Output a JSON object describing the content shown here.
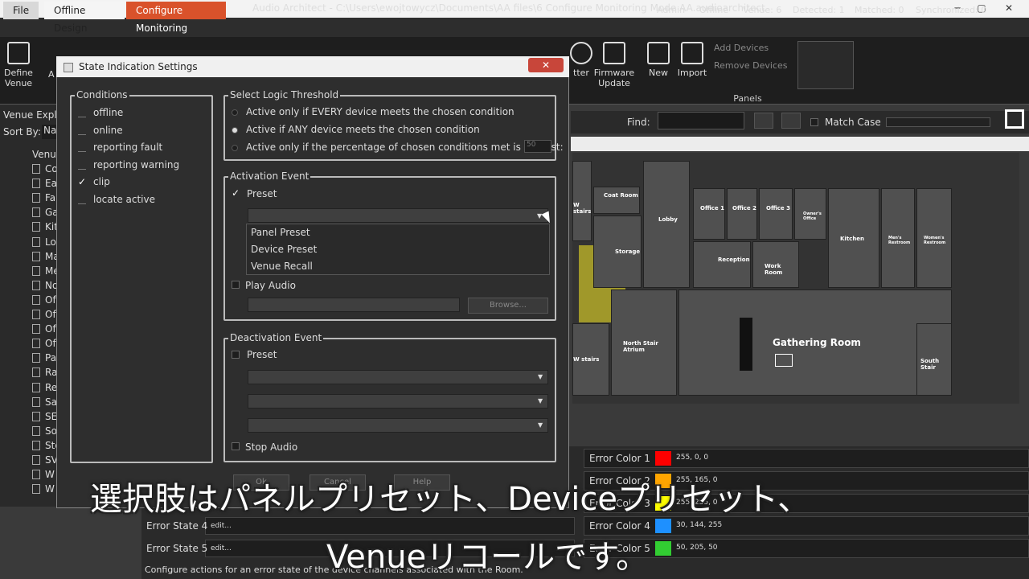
{
  "window": {
    "title": "Audio Architect - C:\\Users\\ewojtowycz\\Documents\\AA files\\6 Configure Monitoring Mode AA.audioarchitect",
    "minimize": "─",
    "maximize": "▢",
    "close": "✕"
  },
  "tabs": {
    "file": "File",
    "offline": "Offline Design",
    "monitor": "Configure Monitoring"
  },
  "status_bar": {
    "admin": "Admin",
    "offline": "Offline",
    "venue": "Venue: 6",
    "detected": "Detected: 1",
    "matched": "Matched: 0",
    "synchronized": "Synchronized: 0"
  },
  "ribbon": {
    "define_venue": "Define Venue",
    "a_dev": "A Dev",
    "tter": "tter",
    "firmware": "Firmware Update",
    "new": "New",
    "import": "Import",
    "add_devices": "Add Devices",
    "remove_devices": "Remove Devices",
    "panels": "Panels"
  },
  "left": {
    "header": "Venue Explo",
    "sort_by": "Sort By:",
    "sort_val": "Na",
    "root": "Venu",
    "items": [
      "Co",
      "Ea",
      "Fa",
      "Ga",
      "Kit",
      "Lo",
      "Ma",
      "Me",
      "No",
      "Of",
      "Of",
      "Of",
      "Of",
      "Pa",
      "Ra",
      "Re",
      "Sa",
      "SE",
      "So",
      "Sto",
      "SV",
      "W",
      "W"
    ]
  },
  "find": {
    "label": "Find:",
    "match_case": "Match Case"
  },
  "map": {
    "rooms": {
      "coat": "Coat Room",
      "lobby": "Lobby",
      "office1": "Office 1",
      "office2": "Office 2",
      "office3": "Office 3",
      "owner": "Owner's Office",
      "kitchen": "Kitchen",
      "mens": "Men's Restroom",
      "womens": "Women's Restroom",
      "storage": "Storage",
      "reception": "Reception",
      "work": "Work Room",
      "gathering": "Gathering Room",
      "north": "North Stair Atrium",
      "south": "South Stair",
      "wstairs": "W stairs",
      "wstairs2": "W stairs"
    }
  },
  "dialog": {
    "title": "State Indication Settings",
    "close": "✕",
    "conditions_title": "Conditions",
    "conditions": [
      {
        "label": "offline",
        "checked": false
      },
      {
        "label": "online",
        "checked": false
      },
      {
        "label": "reporting fault",
        "checked": false
      },
      {
        "label": "reporting warning",
        "checked": false
      },
      {
        "label": "clip",
        "checked": true
      },
      {
        "label": "locate active",
        "checked": false
      }
    ],
    "check_mark": "✓",
    "logic_title": "Select Logic Threshold",
    "logic": [
      {
        "label": "Active only if EVERY device meets the chosen condition",
        "selected": false
      },
      {
        "label": "Active if ANY device meets the chosen condition",
        "selected": true
      },
      {
        "label": "Active only if the percentage of chosen conditions met is at least:",
        "selected": false
      }
    ],
    "percent": "50",
    "activation_title": "Activation Event",
    "preset": "Preset",
    "dropdown_items": [
      "Panel Preset",
      "Device Preset",
      "Venue Recall"
    ],
    "play_audio": "Play Audio",
    "browse": "Browse...",
    "deactivation_title": "Deactivation Event",
    "deact_preset": "Preset",
    "stop_audio": "Stop Audio",
    "ok": "Ok",
    "cancel": "Cancel",
    "help": "Help"
  },
  "errors": {
    "colors": [
      {
        "label": "Error Color 1",
        "value": "255, 0, 0",
        "hex": "#ff0000"
      },
      {
        "label": "Error Color 2",
        "value": "255, 165, 0",
        "hex": "#ffa500"
      },
      {
        "label": "Error Color 3",
        "value": "255, 255, 0",
        "hex": "#ffff00"
      },
      {
        "label": "Error Color 4",
        "value": "30, 144, 255",
        "hex": "#1e90ff"
      },
      {
        "label": "Error Color 5",
        "value": "50, 205, 50",
        "hex": "#32cd32"
      }
    ],
    "states": [
      {
        "label": "Error State 4",
        "edit": "edit..."
      },
      {
        "label": "Error State 5",
        "edit": "edit..."
      }
    ],
    "status": "Configure actions for an error state of the device channels associated with the Room."
  },
  "subtitles": {
    "line1": "選択肢はパネルプリセット、Deviceプリセット、",
    "line2": "Venueリコールです。"
  }
}
